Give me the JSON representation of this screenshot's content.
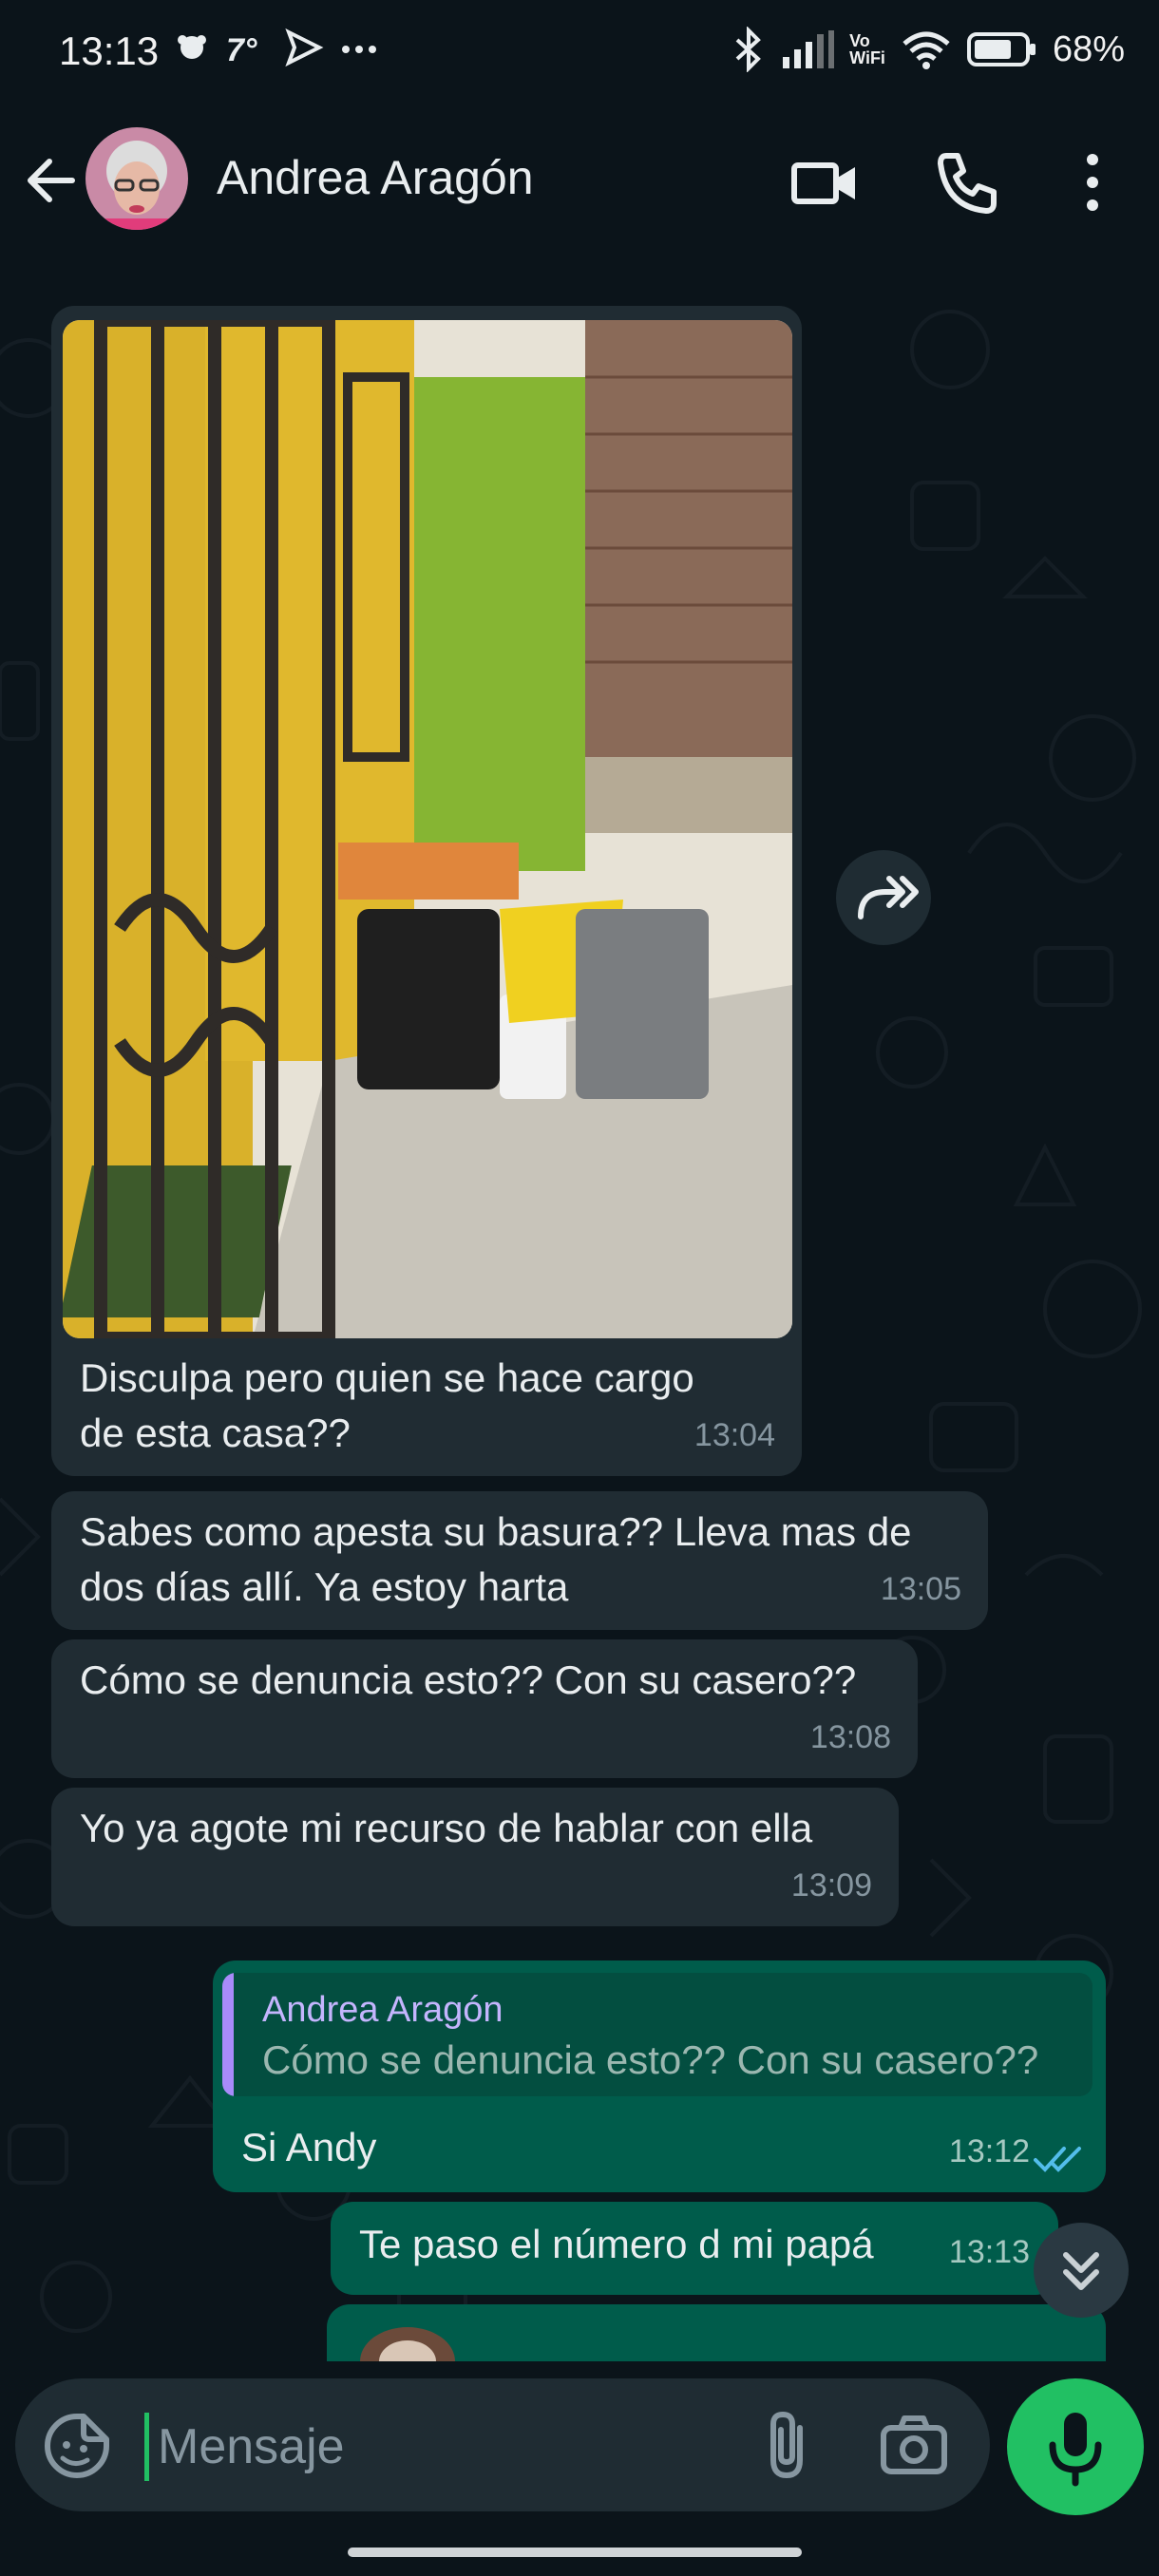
{
  "status_bar": {
    "time": "13:13",
    "battery": "68%",
    "vo_label_1": "Vo",
    "vo_label_2": "WiFi"
  },
  "header": {
    "contact_name": "Andrea Aragón"
  },
  "messages": [
    {
      "text_line1": "Disculpa pero quien se hace cargo",
      "text_line2": "de esta casa??",
      "time": "13:04",
      "direction": "in",
      "has_image": true
    },
    {
      "text_line1": "Sabes como apesta su basura?? Lleva mas de",
      "text_line2": "dos días allí.  Ya estoy harta",
      "time": "13:05",
      "direction": "in"
    },
    {
      "text": "Cómo se denuncia esto?? Con su casero??",
      "time": "13:08",
      "direction": "in"
    },
    {
      "text": "Yo ya agote mi recurso de hablar con ella",
      "time": "13:09",
      "direction": "in"
    },
    {
      "quote_name": "Andrea Aragón",
      "quote_text": "Cómo se denuncia esto?? Con su casero??",
      "text": "Si Andy",
      "time": "13:12",
      "direction": "out",
      "status": "read"
    },
    {
      "text": "Te paso el número d mi papá",
      "time": "13:13",
      "direction": "out"
    }
  ],
  "input": {
    "placeholder": "Mensaje"
  },
  "colors": {
    "background": "#0b141a",
    "incoming_bubble": "#202c33",
    "outgoing_bubble": "#005c4b",
    "accent_green": "#21c063",
    "read_ticks": "#53bdeb"
  }
}
